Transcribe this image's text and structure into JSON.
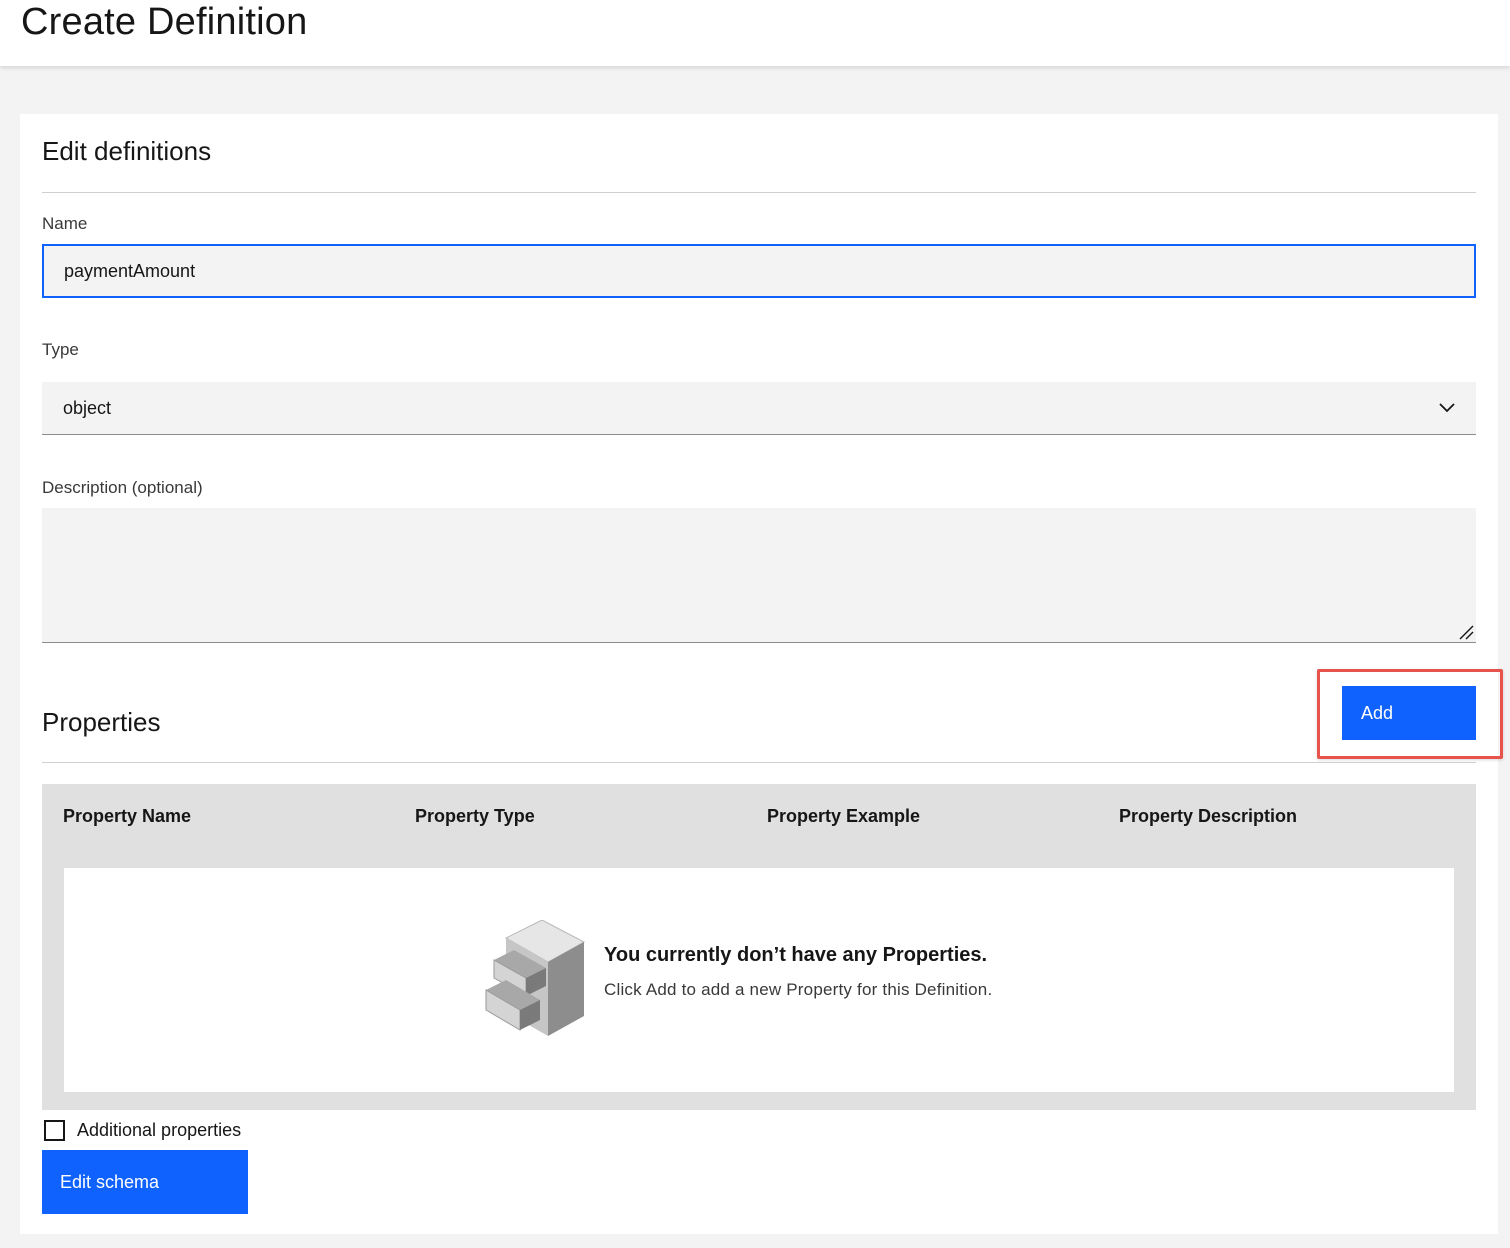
{
  "header": {
    "title": "Create Definition"
  },
  "panel": {
    "title": "Edit definitions",
    "name_field": {
      "label": "Name",
      "value": "paymentAmount"
    },
    "type_field": {
      "label": "Type",
      "value": "object"
    },
    "description_field": {
      "label": "Description (optional)",
      "value": ""
    },
    "properties": {
      "title": "Properties",
      "add_label": "Add",
      "columns": [
        "Property Name",
        "Property Type",
        "Property Example",
        "Property Description"
      ],
      "empty_title": "You currently don’t have any Properties.",
      "empty_subtitle": "Click Add to add a new Property for this Definition."
    },
    "additional_properties": {
      "label": "Additional properties",
      "checked": false
    },
    "edit_schema_label": "Edit schema"
  },
  "colors": {
    "primary": "#0f62fe",
    "highlight": "#e5534b",
    "field_bg": "#f3f3f3",
    "table_header_bg": "#e0e0e0"
  },
  "icons": [
    "chevron-down-icon",
    "resize-handle-icon",
    "filing-cabinet-icon"
  ]
}
